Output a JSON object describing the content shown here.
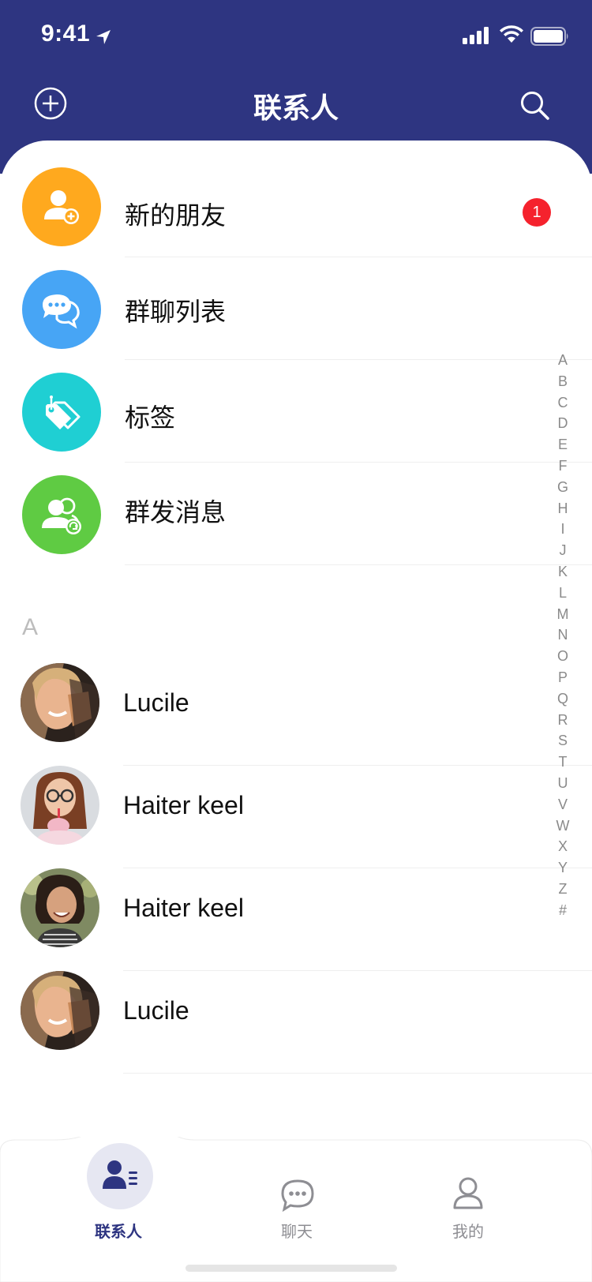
{
  "status_bar": {
    "time": "9:41"
  },
  "nav": {
    "title": "联系人"
  },
  "menu": [
    {
      "label": "新的朋友",
      "icon": "add-friend-icon",
      "color": "#FFA91E",
      "badge": "1"
    },
    {
      "label": "群聊列表",
      "icon": "chat-bubbles-icon",
      "color": "#47A5F5",
      "badge": null
    },
    {
      "label": "标签",
      "icon": "tag-icon",
      "color": "#1FCFD3",
      "badge": null
    },
    {
      "label": "群发消息",
      "icon": "group-broadcast-icon",
      "color": "#5FCB43",
      "badge": null
    }
  ],
  "section": {
    "letter": "A"
  },
  "contacts": [
    {
      "name": "Lucile"
    },
    {
      "name": "Haiter keel"
    },
    {
      "name": "Haiter keel"
    },
    {
      "name": "Lucile"
    }
  ],
  "index_letters": [
    "A",
    "B",
    "C",
    "D",
    "E",
    "F",
    "G",
    "H",
    "I",
    "J",
    "K",
    "L",
    "M",
    "N",
    "O",
    "P",
    "Q",
    "R",
    "S",
    "T",
    "U",
    "V",
    "W",
    "X",
    "Y",
    "Z",
    "#"
  ],
  "tabs": [
    {
      "label": "联系人",
      "icon": "contacts-icon",
      "active": true
    },
    {
      "label": "聊天",
      "icon": "chat-icon",
      "active": false
    },
    {
      "label": "我的",
      "icon": "profile-icon",
      "active": false
    }
  ],
  "colors": {
    "primary": "#2E3581",
    "badge": "#F5222D",
    "background": "#FFFFFF"
  }
}
